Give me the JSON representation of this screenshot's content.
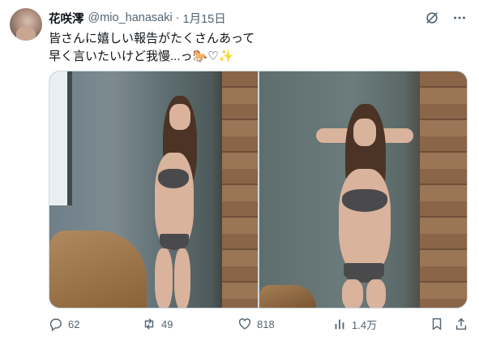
{
  "post": {
    "display_name": "花咲澪",
    "handle": "@mio_hanasaki",
    "separator": "·",
    "date": "1月15日",
    "text": "皆さんに嬉しい報告がたくさんあって\n早く言いたいけど我慢...っ🐎♡✨",
    "media": [
      {
        "name": "photo-1"
      },
      {
        "name": "photo-2"
      }
    ]
  },
  "actions": {
    "replies": "62",
    "reposts": "49",
    "likes": "818",
    "views": "1.4万"
  },
  "icons": {
    "grok": "grok-icon",
    "more": "more-icon",
    "reply": "reply-icon",
    "repost": "repost-icon",
    "like": "heart-icon",
    "views": "views-icon",
    "bookmark": "bookmark-icon",
    "share": "share-icon"
  },
  "colors": {
    "text": "#0f1419",
    "secondary": "#536471",
    "border": "#cfd9de"
  }
}
